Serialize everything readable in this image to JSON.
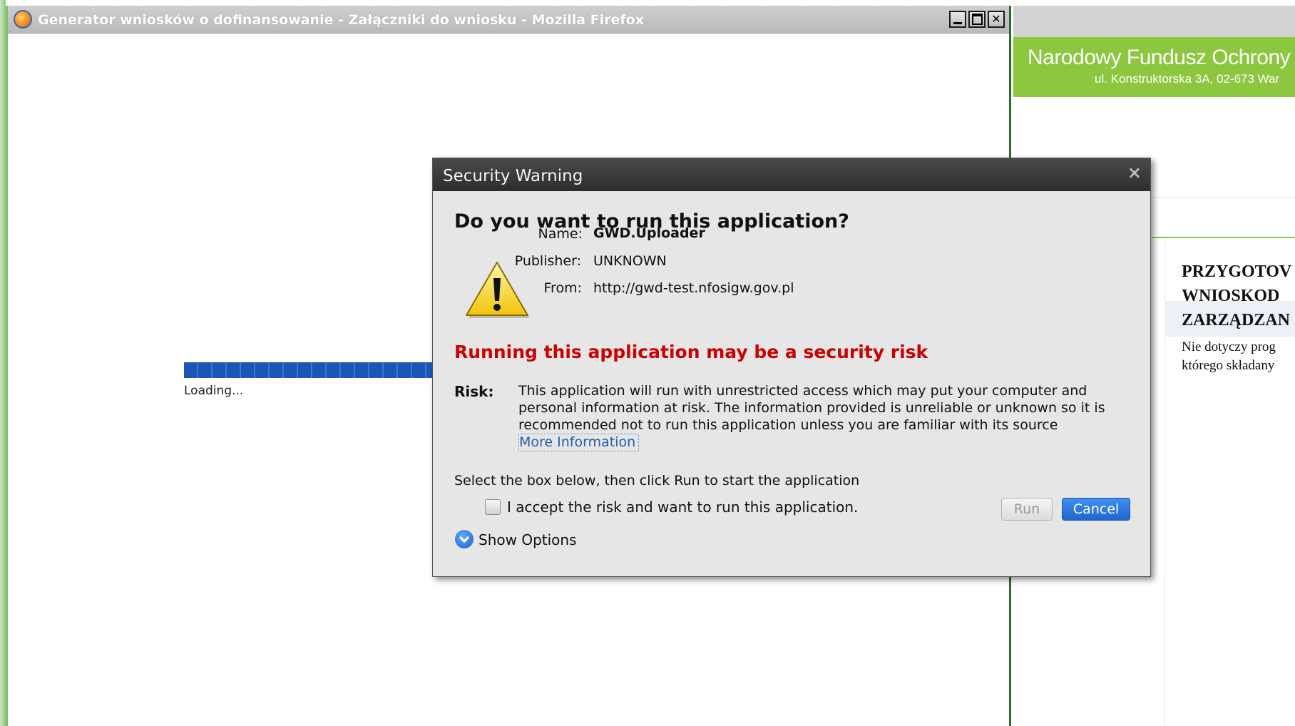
{
  "browser": {
    "window_title": "Generator wniosków o dofinansowanie - Załączniki do wniosku - Mozilla Firefox",
    "icon": "firefox-icon",
    "controls": [
      "minimize-icon",
      "maximize-icon",
      "close-icon"
    ],
    "close_glyph": "✕"
  },
  "page": {
    "loading_text": "Loading..."
  },
  "background_site": {
    "org_name": "Narodowy Fundusz Ochrony Ś",
    "address": "ul. Konstruktorska 3A, 02-673 War",
    "heading_lines": [
      "PRZYGOTOV",
      "WNIOSKOD",
      "ZARZĄDZAN"
    ],
    "desc_lines": [
      "Nie dotyczy prog",
      "którego składany"
    ],
    "brand_color": "#8dc63f"
  },
  "dialog": {
    "title": "Security Warning",
    "close_glyph": "×",
    "question": "Do you want to run this application?",
    "fields": {
      "name_label": "Name:",
      "name_value": "GWD.Uploader",
      "publisher_label": "Publisher:",
      "publisher_value": "UNKNOWN",
      "from_label": "From:",
      "from_value": "http://gwd-test.nfosigw.gov.pl"
    },
    "risk_headline": "Running this application may be a security risk",
    "risk_label": "Risk:",
    "risk_text": "This application will run with unrestricted access which may put your computer and personal information at risk. The information provided is unreliable or unknown so it is recommended not to run this application unless you are familiar with its source",
    "more_info_link": "More Information",
    "instruction": "Select the box below, then click Run to start the application",
    "checkbox_label": "I accept the risk and want to run this application.",
    "checkbox_checked": false,
    "run_button": "Run",
    "cancel_button": "Cancel",
    "show_options": "Show Options",
    "colors": {
      "risk_red": "#cc0000",
      "cancel_blue": "#1f67d2"
    }
  }
}
